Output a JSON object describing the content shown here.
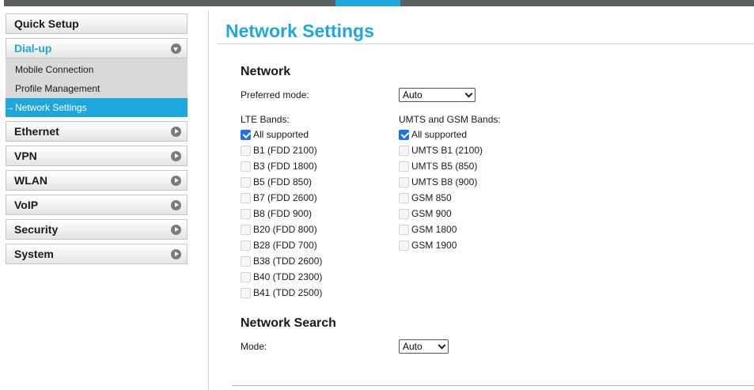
{
  "sidebar": {
    "items": [
      {
        "label": "Quick Setup"
      },
      {
        "label": "Dial-up",
        "sub": [
          "Mobile Connection",
          "Profile Management",
          "Network Settings"
        ]
      },
      {
        "label": "Ethernet"
      },
      {
        "label": "VPN"
      },
      {
        "label": "WLAN"
      },
      {
        "label": "VoIP"
      },
      {
        "label": "Security"
      },
      {
        "label": "System"
      }
    ],
    "active_arrow": "→"
  },
  "main": {
    "title": "Network Settings",
    "network": {
      "heading": "Network",
      "preferred_mode_label": "Preferred mode:",
      "preferred_mode_value": "Auto",
      "lte_label": "LTE Bands:",
      "umts_label": "UMTS and GSM Bands:",
      "lte_bands": [
        "All supported",
        "B1 (FDD 2100)",
        "B3 (FDD 1800)",
        "B5 (FDD 850)",
        "B7 (FDD 2600)",
        "B8 (FDD 900)",
        "B20 (FDD 800)",
        "B28 (FDD 700)",
        "B38 (TDD 2600)",
        "B40 (TDD 2300)",
        "B41 (TDD 2500)"
      ],
      "umts_bands": [
        "All supported",
        "UMTS B1 (2100)",
        "UMTS B5 (850)",
        "UMTS B8 (900)",
        "GSM 850",
        "GSM 900",
        "GSM 1800",
        "GSM 1900"
      ]
    },
    "search": {
      "heading": "Network Search",
      "mode_label": "Mode:",
      "mode_value": "Auto"
    }
  },
  "colors": {
    "accent": "#1ea7dd",
    "topbar": "#5a5f62",
    "checkbox": "#1a73e8"
  }
}
